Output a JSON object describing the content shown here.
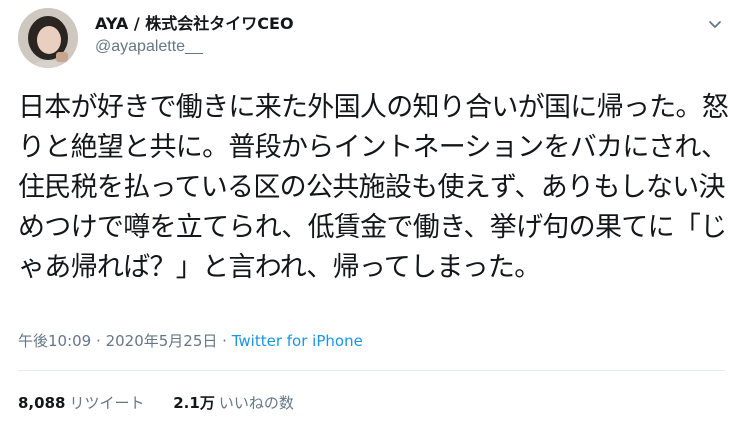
{
  "author": {
    "display_name": "AYA / 株式会社タイワCEO",
    "handle": "@ayapalette__"
  },
  "tweet": {
    "text": "日本が好きで働きに来た外国人の知り合いが国に帰った。怒りと絶望と共に。普段からイントネーションをバカにされ、住民税を払っている区の公共施設も使えず、ありもしない決めつけで噂を立てられ、低賃金で働き、挙げ句の果てに「じゃあ帰れば？」と言われ、帰ってしまった。",
    "time": "午後10:09",
    "separator": "·",
    "date": "2020年5月25日",
    "source": "Twitter for iPhone"
  },
  "stats": {
    "retweets_count": "8,088",
    "retweets_label": "リツイート",
    "likes_count": "2.1万",
    "likes_label": "いいねの数"
  },
  "colors": {
    "text": "#14171a",
    "secondary": "#657786",
    "link": "#1b95e0",
    "divider": "#e6ecf0"
  },
  "icons": {
    "menu": "chevron-down-icon",
    "avatar": "profile-photo"
  }
}
